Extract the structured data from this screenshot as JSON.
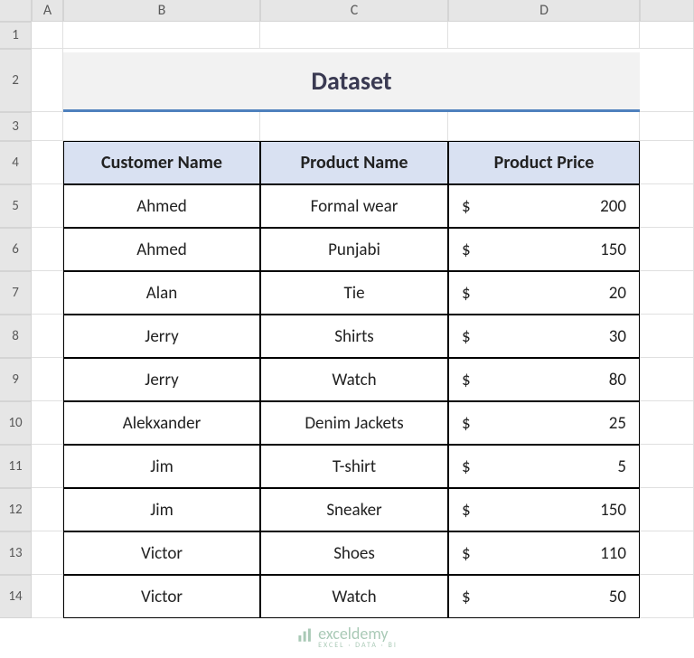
{
  "columns": [
    "A",
    "B",
    "C",
    "D"
  ],
  "rows": [
    "1",
    "2",
    "3",
    "4",
    "5",
    "6",
    "7",
    "8",
    "9",
    "10",
    "11",
    "12",
    "13",
    "14"
  ],
  "title": "Dataset",
  "headers": {
    "customer": "Customer Name",
    "product": "Product Name",
    "price": "Product Price"
  },
  "currency": "$",
  "data": [
    {
      "customer": "Ahmed",
      "product": "Formal wear",
      "price": "200"
    },
    {
      "customer": "Ahmed",
      "product": "Punjabi",
      "price": "150"
    },
    {
      "customer": "Alan",
      "product": "Tie",
      "price": "20"
    },
    {
      "customer": "Jerry",
      "product": "Shirts",
      "price": "30"
    },
    {
      "customer": "Jerry",
      "product": "Watch",
      "price": "80"
    },
    {
      "customer": "Alekxander",
      "product": "Denim Jackets",
      "price": "25"
    },
    {
      "customer": "Jim",
      "product": "T-shirt",
      "price": "5"
    },
    {
      "customer": "Jim",
      "product": "Sneaker",
      "price": "150"
    },
    {
      "customer": "Victor",
      "product": "Shoes",
      "price": "110"
    },
    {
      "customer": "Victor",
      "product": "Watch",
      "price": "50"
    }
  ],
  "watermark": {
    "text": "exceldemy",
    "sub": "EXCEL · DATA · BI"
  },
  "chart_data": {
    "type": "table",
    "title": "Dataset",
    "columns": [
      "Customer Name",
      "Product Name",
      "Product Price"
    ],
    "rows": [
      [
        "Ahmed",
        "Formal wear",
        200
      ],
      [
        "Ahmed",
        "Punjabi",
        150
      ],
      [
        "Alan",
        "Tie",
        20
      ],
      [
        "Jerry",
        "Shirts",
        30
      ],
      [
        "Jerry",
        "Watch",
        80
      ],
      [
        "Alekxander",
        "Denim Jackets",
        25
      ],
      [
        "Jim",
        "T-shirt",
        5
      ],
      [
        "Jim",
        "Sneaker",
        150
      ],
      [
        "Victor",
        "Shoes",
        110
      ],
      [
        "Victor",
        "Watch",
        50
      ]
    ]
  }
}
